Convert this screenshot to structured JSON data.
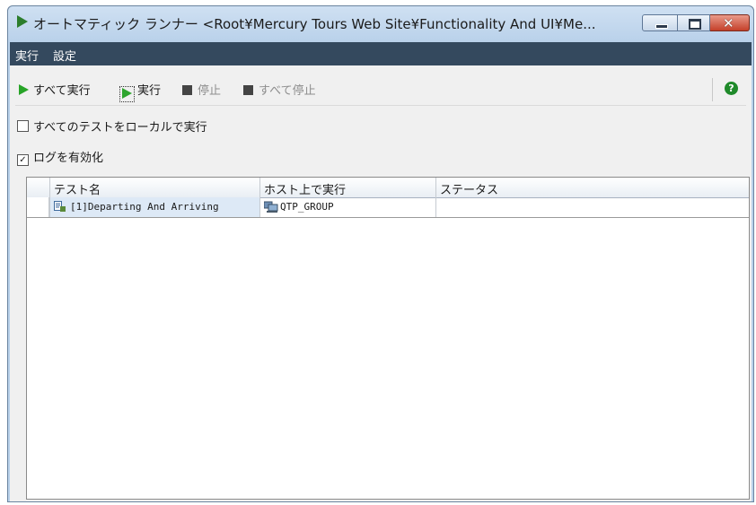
{
  "window": {
    "title": "オートマティック ランナー <Root¥Mercury Tours Web Site¥Functionality And UI¥Me...",
    "close_glyph": "✕"
  },
  "menu": {
    "items": [
      "実行",
      "設定"
    ]
  },
  "toolbar": {
    "run_all_label": "すべて実行",
    "run_label": "実行",
    "stop_label": "停止",
    "stop_all_label": "すべて停止",
    "help_glyph": "?"
  },
  "options": {
    "run_all_locally_label": "すべてのテストをローカルで実行",
    "run_all_locally_checked": false,
    "enable_log_label": "ログを有効化",
    "enable_log_checked": true,
    "checked_glyph": "✓"
  },
  "grid": {
    "columns": [
      "テスト名",
      "ホスト上で実行",
      "ステータス"
    ],
    "rows": [
      {
        "test_name": "[1]Departing And Arriving",
        "host": "QTP_GROUP",
        "status": ""
      }
    ]
  },
  "colors": {
    "menubar_bg": "#34495e",
    "run_green": "#27a427",
    "help_green": "#1f8a2a",
    "selected_cell": "#dde9f6"
  },
  "icons": {
    "title": "play-icon",
    "test": "test-script-icon",
    "host": "computer-group-icon",
    "help": "help-icon"
  }
}
